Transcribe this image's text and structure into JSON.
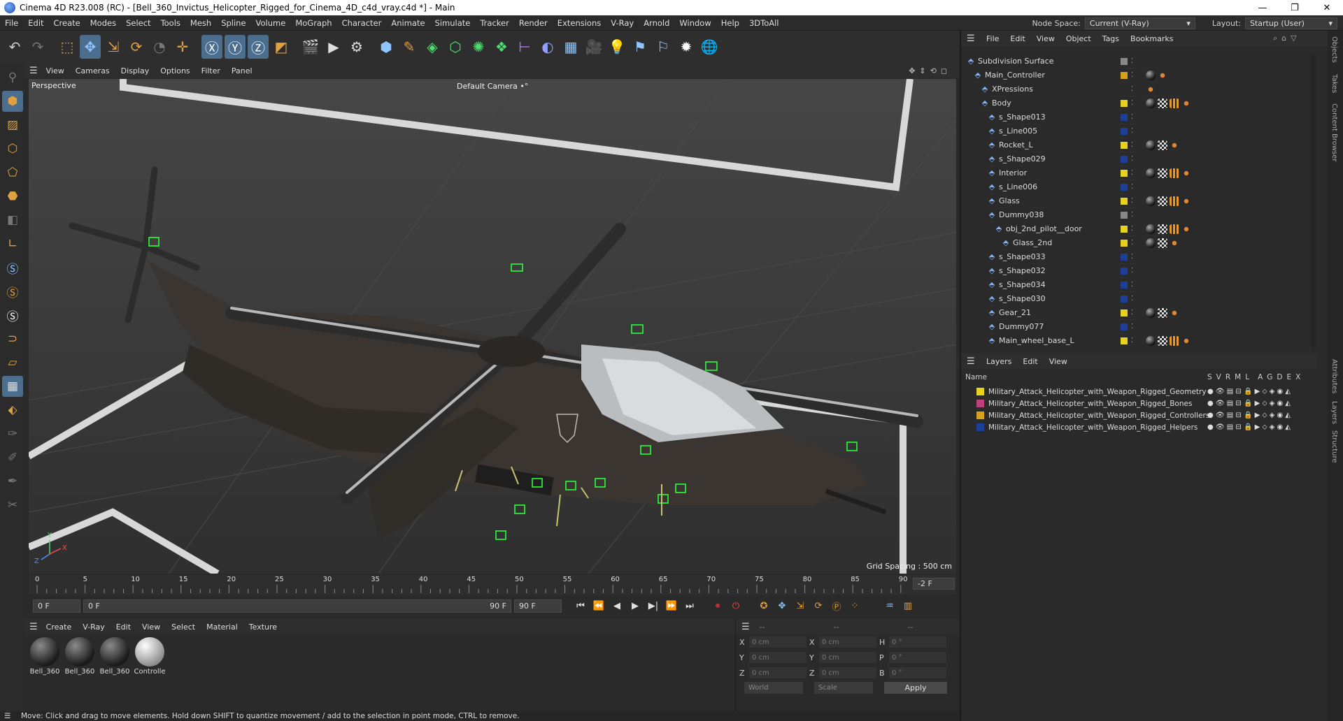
{
  "title_bar": {
    "text": "Cinema 4D R23.008 (RC) - [Bell_360_Invictus_Helicopter_Rigged_for_Cinema_4D_c4d_vray.c4d *] - Main",
    "min": "—",
    "max": "❐",
    "close": "✕"
  },
  "menu": [
    "File",
    "Edit",
    "Create",
    "Modes",
    "Select",
    "Tools",
    "Mesh",
    "Spline",
    "Volume",
    "MoGraph",
    "Character",
    "Animate",
    "Simulate",
    "Tracker",
    "Render",
    "Extensions",
    "V-Ray",
    "Arnold",
    "Window",
    "Help",
    "3DToAll"
  ],
  "node_space": {
    "label": "Node Space:",
    "value": "Current (V-Ray)"
  },
  "layout": {
    "label": "Layout:",
    "value": "Startup (User)"
  },
  "viewport_menu": [
    "View",
    "Cameras",
    "Display",
    "Options",
    "Filter",
    "Panel"
  ],
  "viewport": {
    "name": "Perspective",
    "camera": "Default Camera •°",
    "grid_spacing": "Grid Spacing : 500 cm"
  },
  "timeline": {
    "ticks": [
      "0",
      "5",
      "10",
      "15",
      "20",
      "25",
      "30",
      "35",
      "40",
      "45",
      "50",
      "55",
      "60",
      "65",
      "70",
      "75",
      "80",
      "85",
      "90"
    ],
    "current_end": "-2 F"
  },
  "frames": {
    "start": "0 F",
    "current": "0 F",
    "end_inner": "90 F",
    "end": "90 F"
  },
  "material_menu": [
    "Create",
    "V-Ray",
    "Edit",
    "View",
    "Select",
    "Material",
    "Texture"
  ],
  "materials": [
    {
      "name": "Bell_360",
      "style": "dark"
    },
    {
      "name": "Bell_360",
      "style": "dark"
    },
    {
      "name": "Bell_360",
      "style": "dark"
    },
    {
      "name": "Controlle",
      "style": "white"
    }
  ],
  "attributes": {
    "headers": [
      "--",
      "--",
      "--"
    ],
    "rows": [
      {
        "a": "X",
        "av": "0 cm",
        "b": "X",
        "bv": "0 cm",
        "c": "H",
        "cv": "0 °"
      },
      {
        "a": "Y",
        "av": "0 cm",
        "b": "Y",
        "bv": "0 cm",
        "c": "P",
        "cv": "0 °"
      },
      {
        "a": "Z",
        "av": "0 cm",
        "b": "Z",
        "bv": "0 cm",
        "c": "B",
        "cv": "0 °"
      }
    ],
    "coord": "World",
    "scale": "Scale",
    "apply": "Apply"
  },
  "status": "Move: Click and drag to move elements. Hold down SHIFT to quantize movement / add to the selection in point mode, CTRL to remove.",
  "object_menu": [
    "File",
    "Edit",
    "View",
    "Object",
    "Tags",
    "Bookmarks"
  ],
  "objects": [
    {
      "name": "Subdivision Surface",
      "indent": 0,
      "layer": "#888888",
      "tags": []
    },
    {
      "name": "Main_Controller",
      "indent": 1,
      "layer": "#d6a21c",
      "tags": [
        "sph",
        "dot"
      ]
    },
    {
      "name": "XPressions",
      "indent": 2,
      "layer": "",
      "tags": [
        "dot"
      ]
    },
    {
      "name": "Body",
      "indent": 2,
      "layer": "#e6d21c",
      "tags": [
        "sph",
        "chk",
        "grd",
        "dot"
      ]
    },
    {
      "name": "s_Shape013",
      "indent": 3,
      "layer": "#1d3f9a",
      "tags": []
    },
    {
      "name": "s_Line005",
      "indent": 3,
      "layer": "#1d3f9a",
      "tags": []
    },
    {
      "name": "Rocket_L",
      "indent": 3,
      "layer": "#e6d21c",
      "tags": [
        "sph",
        "chk",
        "dot"
      ]
    },
    {
      "name": "s_Shape029",
      "indent": 3,
      "layer": "#1d3f9a",
      "tags": []
    },
    {
      "name": "Interior",
      "indent": 3,
      "layer": "#e6d21c",
      "tags": [
        "sph",
        "chk",
        "grd",
        "dot"
      ]
    },
    {
      "name": "s_Line006",
      "indent": 3,
      "layer": "#1d3f9a",
      "tags": []
    },
    {
      "name": "Glass",
      "indent": 3,
      "layer": "#e6d21c",
      "tags": [
        "sph",
        "chk",
        "grd",
        "dot"
      ]
    },
    {
      "name": "Dummy038",
      "indent": 3,
      "layer": "#888888",
      "tags": []
    },
    {
      "name": "obj_2nd_pilot__door",
      "indent": 4,
      "layer": "#e6d21c",
      "tags": [
        "sph",
        "chk",
        "grd",
        "dot"
      ]
    },
    {
      "name": "Glass_2nd",
      "indent": 5,
      "layer": "#e6d21c",
      "tags": [
        "sph",
        "chk",
        "dot"
      ]
    },
    {
      "name": "s_Shape033",
      "indent": 3,
      "layer": "#1d3f9a",
      "tags": []
    },
    {
      "name": "s_Shape032",
      "indent": 3,
      "layer": "#1d3f9a",
      "tags": []
    },
    {
      "name": "s_Shape034",
      "indent": 3,
      "layer": "#1d3f9a",
      "tags": []
    },
    {
      "name": "s_Shape030",
      "indent": 3,
      "layer": "#1d3f9a",
      "tags": []
    },
    {
      "name": "Gear_21",
      "indent": 3,
      "layer": "#e6d21c",
      "tags": [
        "sph",
        "chk",
        "dot"
      ]
    },
    {
      "name": "Dummy077",
      "indent": 3,
      "layer": "#1d3f9a",
      "tags": []
    },
    {
      "name": "Main_wheel_base_L",
      "indent": 3,
      "layer": "#e6d21c",
      "tags": [
        "sph",
        "chk",
        "grd",
        "dot"
      ]
    }
  ],
  "layers_menu": [
    "Layers",
    "Edit",
    "View"
  ],
  "layers_header": {
    "name": "Name",
    "cols": [
      "S",
      "V",
      "R",
      "M",
      "L",
      "A",
      "G",
      "D",
      "E",
      "X"
    ]
  },
  "layers": [
    {
      "name": "Military_Attack_Helicopter_with_Weapon_Rigged_Geometry",
      "color": "#e6d21c"
    },
    {
      "name": "Military_Attack_Helicopter_with_Weapon_Rigged_Bones",
      "color": "#c0407a"
    },
    {
      "name": "Military_Attack_Helicopter_with_Weapon_Rigged_Controllers",
      "color": "#d6a21c"
    },
    {
      "name": "Military_Attack_Helicopter_with_Weapon_Rigged_Helpers",
      "color": "#1d3f9a"
    }
  ],
  "side_tabs": [
    "Objects",
    "Takes",
    "Content Browser",
    "Attributes",
    "Layers",
    "Structure"
  ]
}
